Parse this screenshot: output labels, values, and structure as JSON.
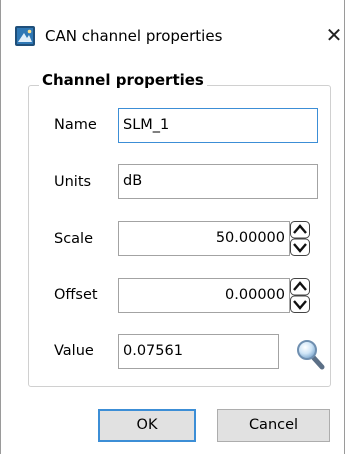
{
  "window": {
    "title": "CAN channel properties",
    "close_glyph": "✕",
    "icon": "app-icon"
  },
  "group": {
    "title": "Channel properties"
  },
  "fields": {
    "name": {
      "label": "Name",
      "value": "SLM_1"
    },
    "units": {
      "label": "Units",
      "value": "dB"
    },
    "scale": {
      "label": "Scale",
      "value": "50.00000"
    },
    "offset": {
      "label": "Offset",
      "value": "0.00000"
    },
    "value": {
      "label": "Value",
      "value": "0.07561"
    }
  },
  "buttons": {
    "ok": "OK",
    "cancel": "Cancel"
  },
  "colors": {
    "focus_border": "#3c8ed6",
    "button_bg": "#e1e1e1"
  }
}
